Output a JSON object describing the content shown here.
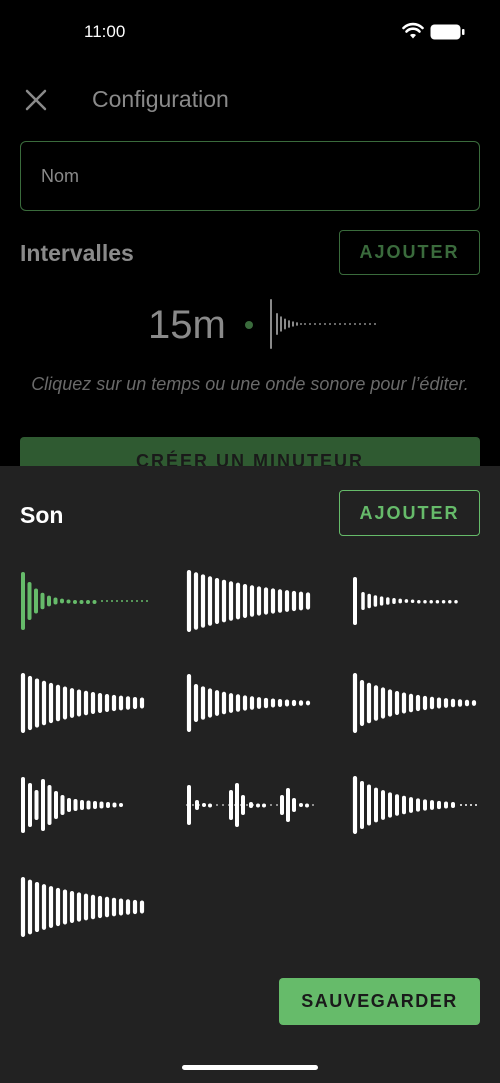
{
  "status_bar": {
    "time": "11:00"
  },
  "header": {
    "title": "Configuration",
    "close_icon": "close-icon"
  },
  "form": {
    "name_placeholder": "Nom"
  },
  "intervals": {
    "label": "Intervalles",
    "add_label": "AJOUTER",
    "item": {
      "time": "15m"
    },
    "hint": "Cliquez sur un temps ou une onde sonore pour l’éditer."
  },
  "create_button": {
    "label": "CRÉER UN MINUTEUR"
  },
  "sound_sheet": {
    "title": "Son",
    "add_label": "AJOUTER",
    "save_label": "SAUVEGARDER",
    "selected_index": 0,
    "sounds": [
      {
        "icon": "waveform-icon",
        "selected": true
      },
      {
        "icon": "waveform-icon",
        "selected": false
      },
      {
        "icon": "waveform-icon",
        "selected": false
      },
      {
        "icon": "waveform-icon",
        "selected": false
      },
      {
        "icon": "waveform-icon",
        "selected": false
      },
      {
        "icon": "waveform-icon",
        "selected": false
      },
      {
        "icon": "waveform-icon",
        "selected": false
      },
      {
        "icon": "waveform-icon",
        "selected": false
      },
      {
        "icon": "waveform-icon",
        "selected": false
      },
      {
        "icon": "waveform-icon",
        "selected": false
      }
    ]
  },
  "colors": {
    "accent": "#66bb6a",
    "accent_dim": "#3a6b3c",
    "sheet_bg": "#222222",
    "background": "#000000"
  }
}
